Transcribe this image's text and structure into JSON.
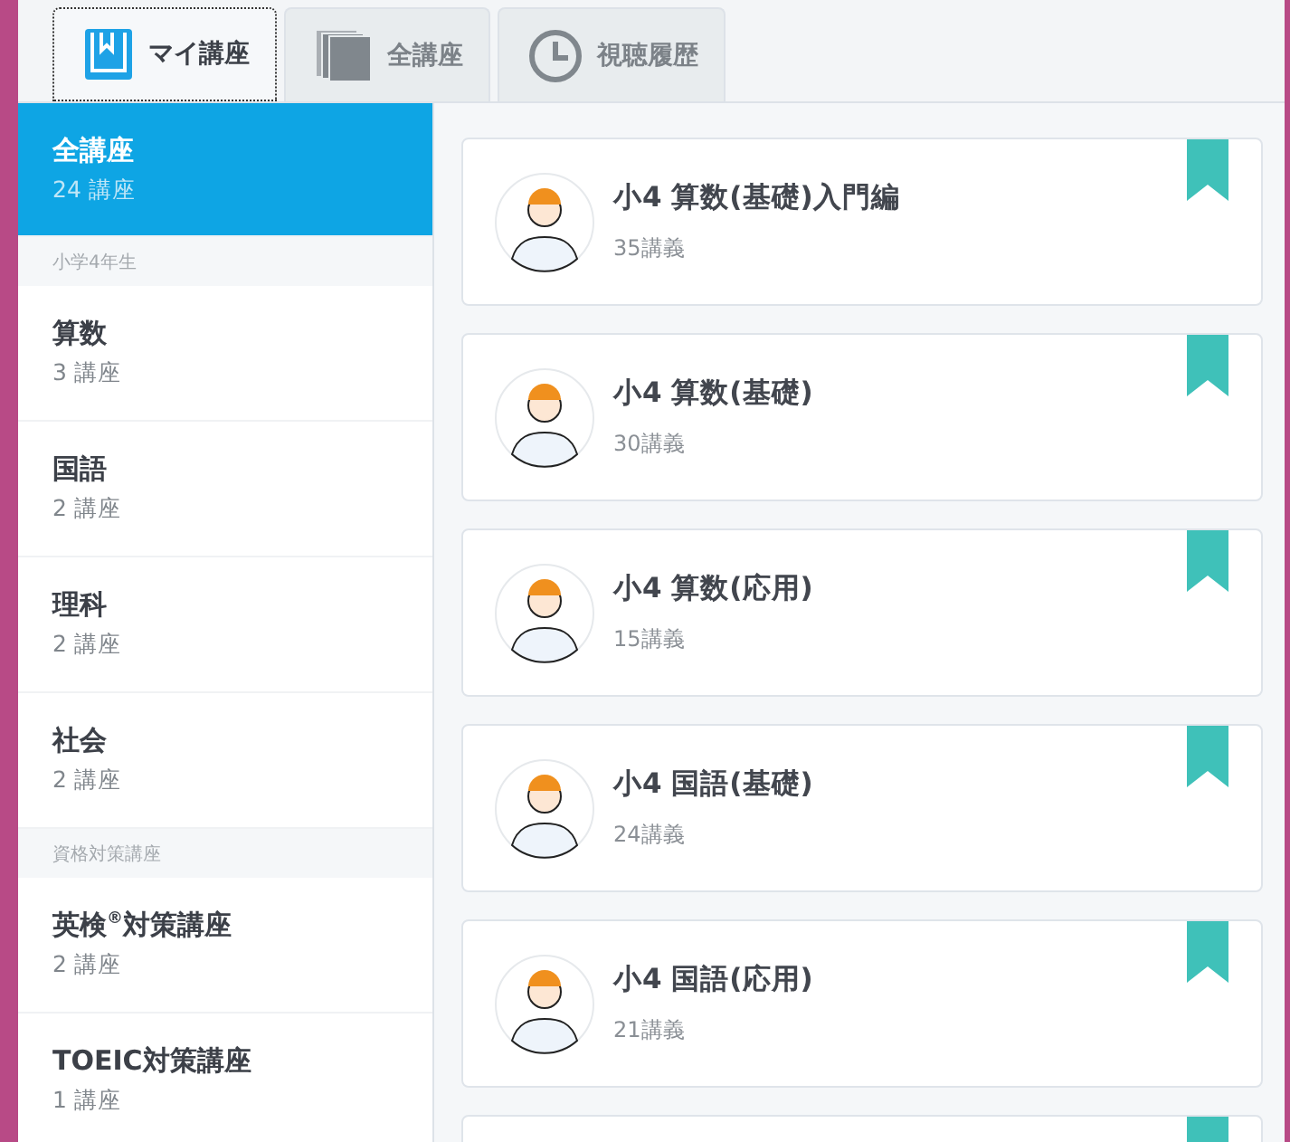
{
  "tabs": [
    {
      "label": "マイ講座",
      "kind": "book",
      "selected": true
    },
    {
      "label": "全講座",
      "kind": "stack",
      "selected": false
    },
    {
      "label": "視聴履歴",
      "kind": "clock",
      "selected": false
    }
  ],
  "sidebar": {
    "items": [
      {
        "kind": "item",
        "title": "全講座",
        "count": "24 講座",
        "selected": true
      },
      {
        "kind": "heading",
        "title": "小学4年生"
      },
      {
        "kind": "item",
        "title": "算数",
        "count": "3 講座",
        "selected": false
      },
      {
        "kind": "item",
        "title": "国語",
        "count": "2 講座",
        "selected": false
      },
      {
        "kind": "item",
        "title": "理科",
        "count": "2 講座",
        "selected": false
      },
      {
        "kind": "item",
        "title": "社会",
        "count": "2 講座",
        "selected": false
      },
      {
        "kind": "heading",
        "title": "資格対策講座"
      },
      {
        "kind": "item",
        "title": "英検$^{®}$対策講座",
        "count": "2 講座",
        "selected": false
      },
      {
        "kind": "item",
        "title": "TOEIC対策講座",
        "count": "1 講座",
        "selected": false
      }
    ]
  },
  "courses": [
    {
      "title": "小4 算数(基礎)入門編",
      "lectures": "35講義",
      "bookmarked": true
    },
    {
      "title": "小4 算数(基礎)",
      "lectures": "30講義",
      "bookmarked": true
    },
    {
      "title": "小4 算数(応用)",
      "lectures": "15講義",
      "bookmarked": true
    },
    {
      "title": "小4 国語(基礎)",
      "lectures": "24講義",
      "bookmarked": true
    },
    {
      "title": "小4 国語(応用)",
      "lectures": "21講義",
      "bookmarked": true
    },
    {
      "bookmarked": true
    }
  ]
}
